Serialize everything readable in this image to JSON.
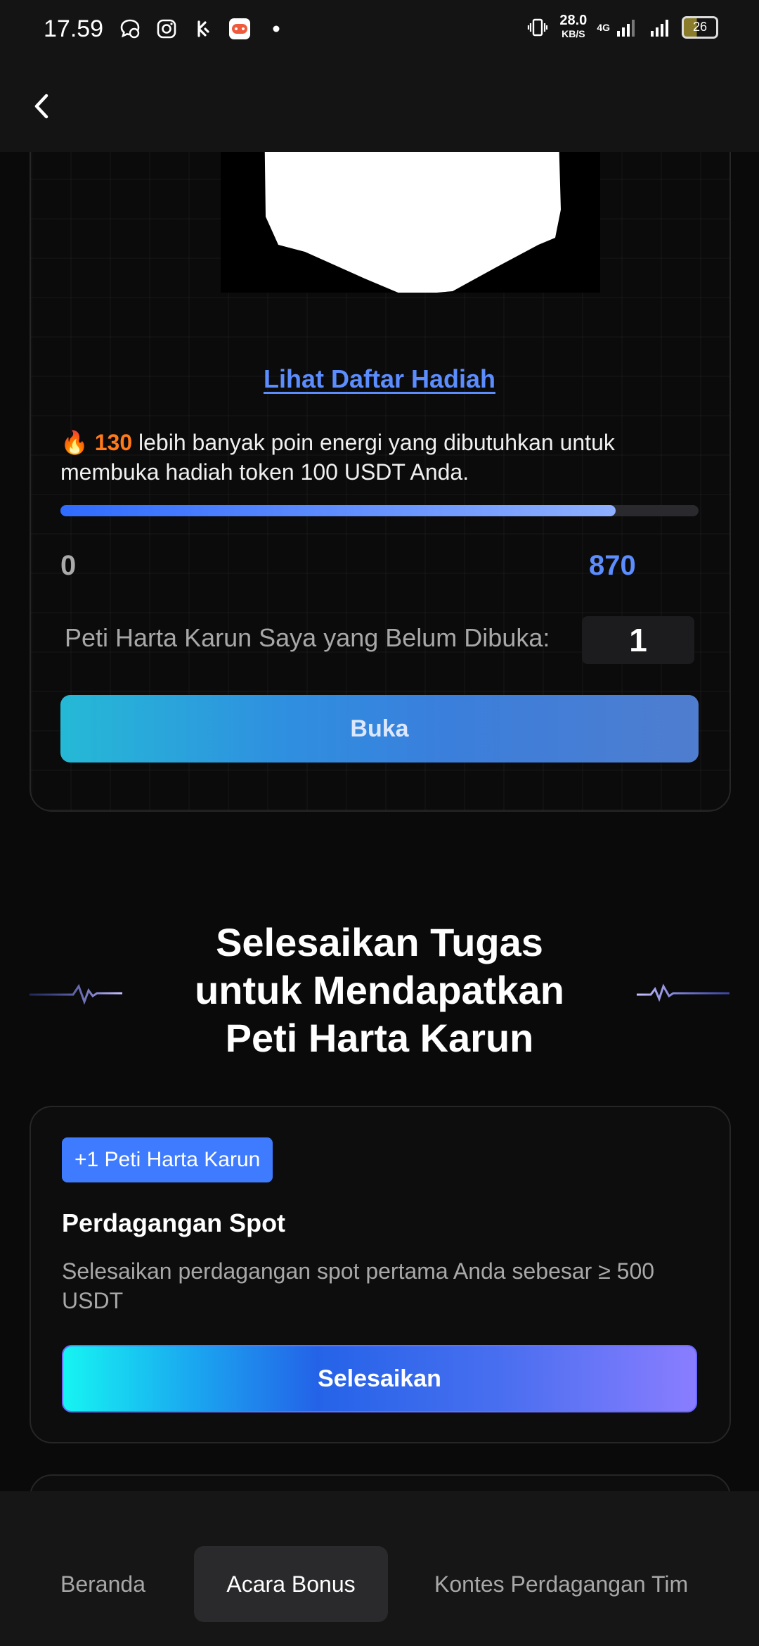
{
  "status_bar": {
    "time": "17.59",
    "net_speed_value": "28.0",
    "net_speed_unit": "KB/S",
    "network_type": "4G",
    "battery_level": "26"
  },
  "header": {
    "back_icon": "chevron-left-icon"
  },
  "reward_card": {
    "view_prizes_link": "Lihat Daftar Hadiah",
    "fire_icon": "🔥",
    "points_needed": "130",
    "progress_message": "lebih banyak poin energi yang dibutuhkan untuk membuka hadiah token 100 USDT Anda.",
    "progress_fraction": 0.87,
    "progress_min": "0",
    "progress_max": "870",
    "unopened_label": "Peti Harta Karun Saya yang Belum Dibuka:",
    "unopened_count": "1",
    "open_button": "Buka"
  },
  "section": {
    "title_line1": "Selesaikan Tugas",
    "title_line2": "untuk Mendapatkan",
    "title_line3": "Peti Harta Karun"
  },
  "task": {
    "badge": "+1 Peti Harta Karun",
    "title": "Perdagangan Spot",
    "description": "Selesaikan perdagangan spot pertama Anda sebesar ≥ 500 USDT",
    "button": "Selesaikan"
  },
  "bottom_nav": {
    "items": [
      {
        "label": "Beranda",
        "active": false
      },
      {
        "label": "Acara Bonus",
        "active": true
      },
      {
        "label": "Kontes Perdagangan Tim",
        "active": false
      }
    ]
  },
  "colors": {
    "accent_blue": "#3f7bff",
    "link_blue": "#5b8dff",
    "points_orange": "#ff7a1a",
    "background": "#0a0a0b"
  }
}
